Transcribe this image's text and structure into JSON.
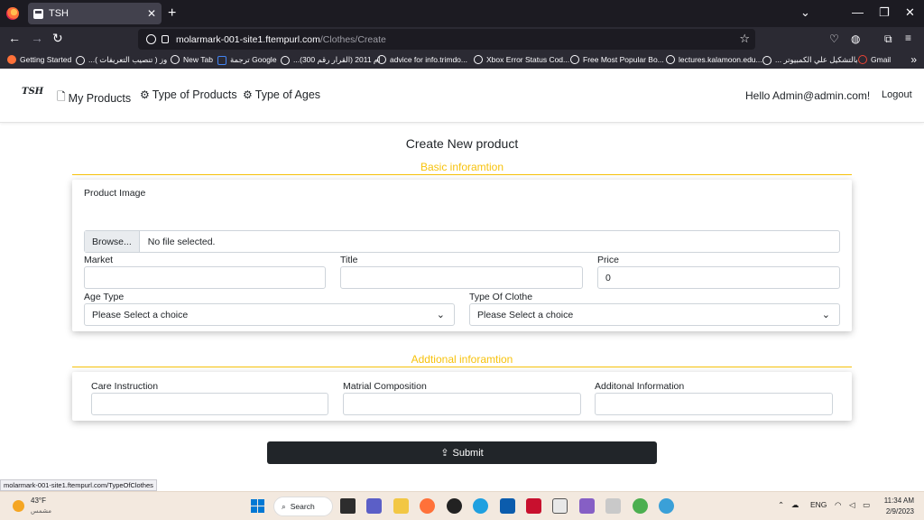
{
  "browser": {
    "tab_title": "TSH",
    "url_host": "molarmark-001-site1.ftempurl.com",
    "url_path": "/Clothes/Create",
    "bookmarks": [
      "Getting Started",
      "...وز ( تنصيب التعريفات )",
      "New Tab",
      "ترجمة Google",
      "...ام 2011 (القرار رقم 300)",
      "advice for info.trimdo...",
      "Xbox Error Status Cod...",
      "Free Most Popular Bo...",
      "lectures.kalamoon.edu...",
      "... بالتشكيل علي الكمبيوتر",
      "Gmail"
    ],
    "status_url": "molarmark-001-site1.ftempurl.com/TypeOfClothes"
  },
  "nav": {
    "brand": "TSH",
    "links": [
      "My Products",
      "Type of Products",
      "Type of Ages"
    ],
    "greeting": "Hello Admin@admin.com!",
    "logout": "Logout"
  },
  "form": {
    "title": "Create New product",
    "basic_section": "Basic inforamtion",
    "image_label": "Product Image",
    "browse_label": "Browse...",
    "file_status": "No file selected.",
    "market_label": "Market",
    "market_value": "",
    "title_label": "Title",
    "title_value": "",
    "price_label": "Price",
    "price_value": "0",
    "age_type_label": "Age Type",
    "age_type_value": "Please Select a choice",
    "clothe_type_label": "Type Of Clothe",
    "clothe_type_value": "Please Select a choice",
    "additional_section": "Addtional inforamtion",
    "care_label": "Care Instruction",
    "matrial_label": "Matrial Composition",
    "additional_label": "Additonal Information",
    "submit_label": "Submit"
  },
  "taskbar": {
    "temperature": "43°F",
    "weather_desc": "مشمس",
    "search_label": "Search",
    "language": "ENG",
    "time": "11:34 AM",
    "date": "2/9/2023"
  },
  "colors": {
    "accent": "#f7c20c",
    "button": "#212529"
  }
}
